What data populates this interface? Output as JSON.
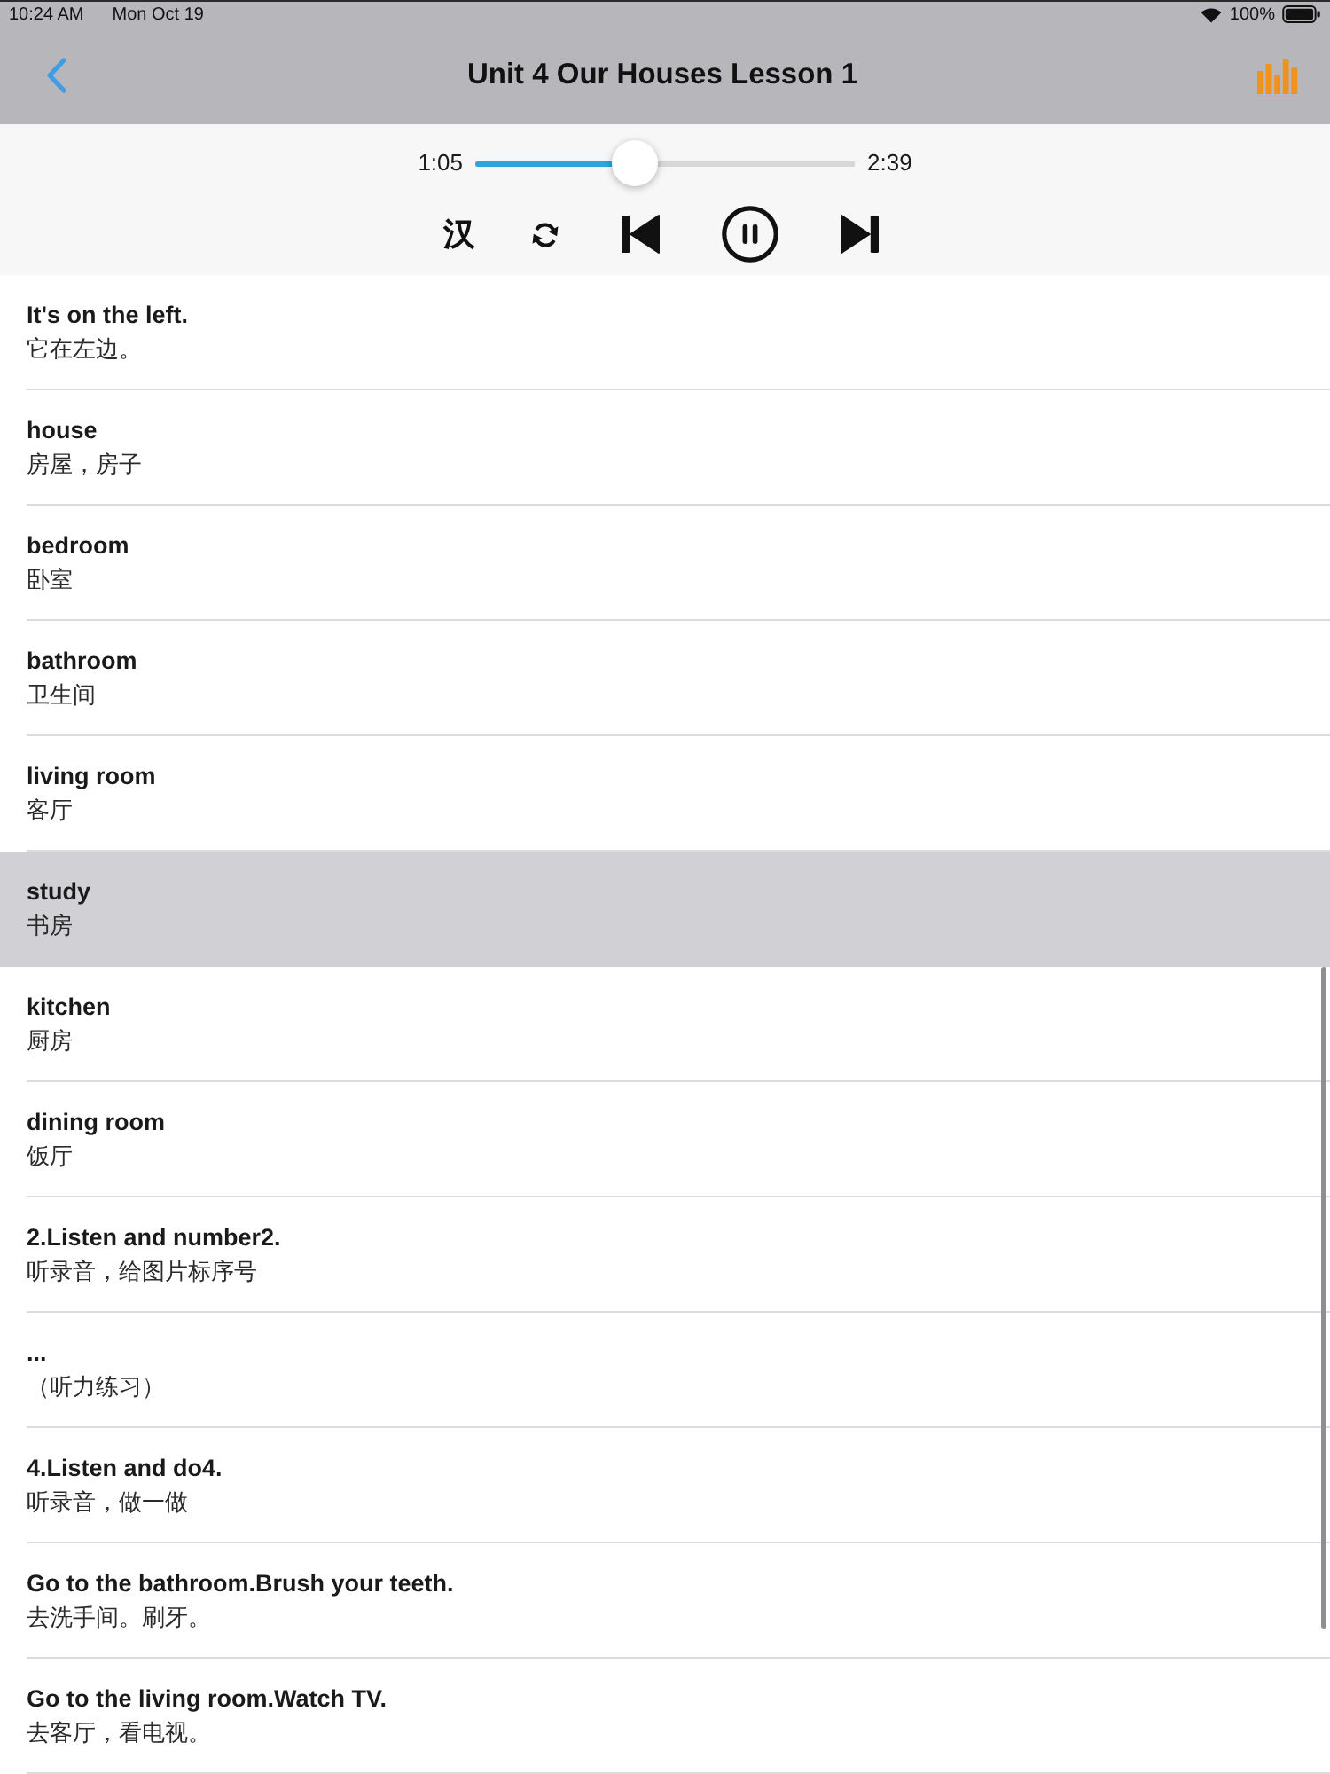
{
  "status_bar": {
    "time": "10:24 AM",
    "date": "Mon Oct 19",
    "battery": "100%"
  },
  "nav_bar": {
    "title": "Unit 4 Our Houses Lesson 1"
  },
  "player": {
    "elapsed": "1:05",
    "level": 0.42,
    "duration": "2:39",
    "controls": [
      {
        "kind": "translate",
        "label": "汉"
      },
      {
        "kind": "repeat"
      },
      {
        "kind": "previous"
      },
      {
        "kind": "pause"
      },
      {
        "kind": "next"
      }
    ]
  },
  "sentences": [
    {
      "english": "It's on the left.",
      "chinese": "它在左边。",
      "selected": false
    },
    {
      "english": "house",
      "chinese": "房屋，房子",
      "selected": false
    },
    {
      "english": "bedroom",
      "chinese": "卧室",
      "selected": false
    },
    {
      "english": "bathroom",
      "chinese": "卫生间",
      "selected": false
    },
    {
      "english": "living room",
      "chinese": "客厅",
      "selected": false
    },
    {
      "english": "study",
      "chinese": "书房",
      "selected": true
    },
    {
      "english": "kitchen",
      "chinese": "厨房",
      "selected": false
    },
    {
      "english": "dining room",
      "chinese": "饭厅",
      "selected": false
    },
    {
      "english": "2.Listen and number2.",
      "chinese": "听录音，给图片标序号",
      "selected": false
    },
    {
      "english": "...",
      "chinese": "（听力练习）",
      "selected": false
    },
    {
      "english": "4.Listen and do4.",
      "chinese": "听录音，做一做",
      "selected": false
    },
    {
      "english": "Go to the bathroom.Brush your teeth.",
      "chinese": "去洗手间。刷牙。",
      "selected": false
    },
    {
      "english": "Go to the living room.Watch TV.",
      "chinese": "去客厅，看电视。",
      "selected": false
    }
  ]
}
